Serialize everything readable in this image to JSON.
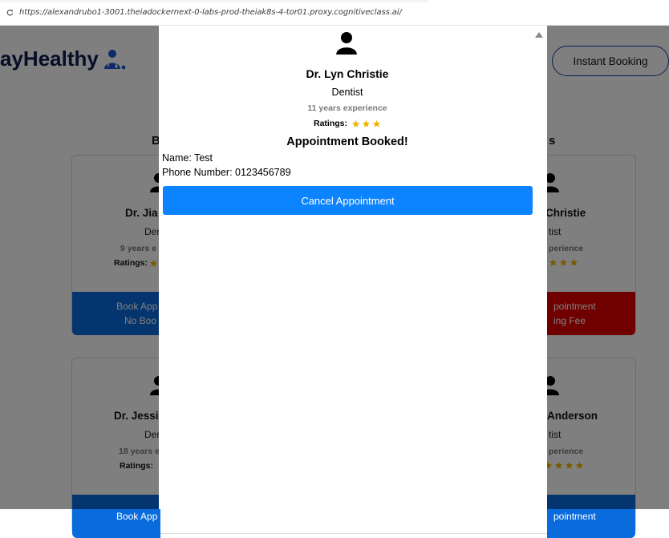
{
  "browser": {
    "url": "https://alexandrubo1-3001.theiadockernext-0-labs-prod-theiak8s-4-tor01.proxy.cognitiveclass.ai/"
  },
  "page": {
    "brand_text": "ayHealthy",
    "instant_booking_label": "Instant Booking",
    "section_heading_left": "B",
    "section_heading_right": "s",
    "cards": [
      {
        "left": {
          "name": "Dr. Jia",
          "speciality": "Den",
          "experience": "9 years e",
          "ratings_label": "Ratings:",
          "button_line1": "Book App",
          "button_line2": "No Boo"
        },
        "right": {
          "name": "Christie",
          "speciality": "tist",
          "experience": "perience",
          "button_line1": "pointment",
          "button_line2": "ing Fee"
        }
      },
      {
        "left": {
          "name": "Dr. Jessi",
          "speciality": "Den",
          "experience": "18 years e",
          "ratings_label": "Ratings:",
          "button_line1": "Book App"
        },
        "right": {
          "name": "Anderson",
          "speciality": "tist",
          "experience": "perience",
          "button_line1": "pointment"
        }
      }
    ]
  },
  "popup": {
    "doctor_name": "Dr. Lyn Christie",
    "speciality": "Dentist",
    "experience": "11 years experience",
    "ratings_label": "Ratings:",
    "rating_stars": 3,
    "status": "Appointment Booked!",
    "name_line": "Name: Test",
    "phone_line": "Phone Number: 0123456789",
    "cancel_label": "Cancel Appointment"
  },
  "colors": {
    "primary_blue": "#0d84ff",
    "card_blue": "#0a6bdc",
    "card_red": "#e00000",
    "star": "#f0b400",
    "brand_navy": "#0d1b4c"
  }
}
